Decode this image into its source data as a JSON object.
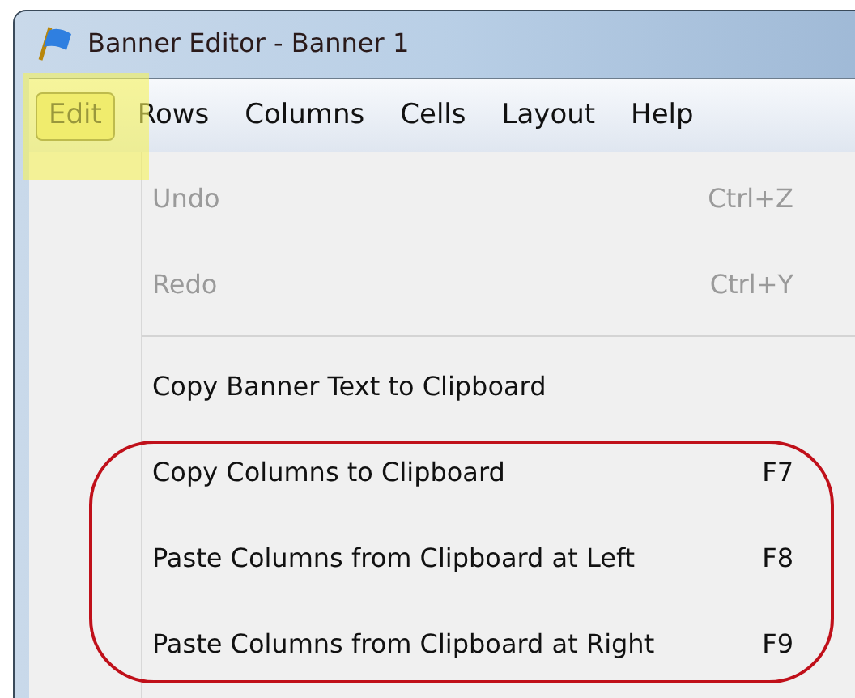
{
  "window": {
    "title": "Banner Editor - Banner 1"
  },
  "menu_bar": [
    {
      "label": "Edit",
      "selected": true
    },
    {
      "label": "Rows",
      "selected": false
    },
    {
      "label": "Columns",
      "selected": false
    },
    {
      "label": "Cells",
      "selected": false
    },
    {
      "label": "Layout",
      "selected": false
    },
    {
      "label": "Help",
      "selected": false
    }
  ],
  "menu": [
    {
      "kind": "item",
      "label": "Undo",
      "shortcut": "Ctrl+Z",
      "disabled": true
    },
    {
      "kind": "item",
      "label": "Redo",
      "shortcut": "Ctrl+Y",
      "disabled": true
    },
    {
      "kind": "separator"
    },
    {
      "kind": "item",
      "label": "Copy Banner Text to Clipboard",
      "disabled": false
    },
    {
      "kind": "item",
      "label": "Copy Columns to Clipboard",
      "shortcut": "F7",
      "disabled": false
    },
    {
      "kind": "item",
      "label": "Paste Columns from Clipboard at Left",
      "shortcut": "F8",
      "disabled": false
    },
    {
      "kind": "item",
      "label": "Paste Columns from Clipboard at Right",
      "shortcut": "F9",
      "disabled": false
    }
  ]
}
